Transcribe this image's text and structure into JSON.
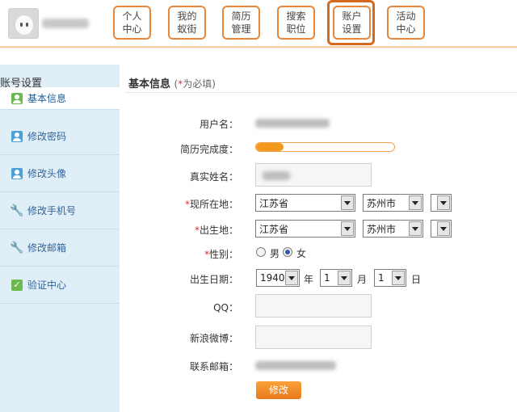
{
  "header": {
    "nav": [
      {
        "line1": "个人",
        "line2": "中心"
      },
      {
        "line1": "我的",
        "line2": "蚁街"
      },
      {
        "line1": "简历",
        "line2": "管理"
      },
      {
        "line1": "搜索",
        "line2": "职位"
      },
      {
        "line1": "账户",
        "line2": "设置"
      },
      {
        "line1": "活动",
        "line2": "中心"
      }
    ]
  },
  "sidebar": {
    "title": "账号设置",
    "items": [
      {
        "label": "基本信息",
        "icon": "user-icon"
      },
      {
        "label": "修改密码",
        "icon": "user-icon"
      },
      {
        "label": "修改头像",
        "icon": "user-icon"
      },
      {
        "label": "修改手机号",
        "icon": "wrench-icon"
      },
      {
        "label": "修改邮箱",
        "icon": "wrench-icon"
      },
      {
        "label": "验证中心",
        "icon": "check-icon"
      }
    ]
  },
  "main": {
    "title": "基本信息",
    "required_note_open": "(",
    "required_star": "*",
    "required_note_text": "为必填)",
    "labels": {
      "username": "用户名：",
      "completion": "简历完成度：",
      "realname": "真实姓名：",
      "current_location": "现所在地：",
      "birthplace": "出生地：",
      "gender": "性别：",
      "birthdate": "出生日期：",
      "qq": "QQ：",
      "weibo": "新浪微博：",
      "email": "联系邮箱："
    },
    "required_mark": "*",
    "resume_completion": 0.2,
    "current_location": {
      "province": "江苏省",
      "city": "苏州市",
      "district": ""
    },
    "birthplace": {
      "province": "江苏省",
      "city": "苏州市",
      "district": ""
    },
    "gender": {
      "male": "男",
      "female": "女",
      "selected": "female"
    },
    "birthdate": {
      "year": "1940",
      "year_unit": "年",
      "month": "1",
      "month_unit": "月",
      "day": "1",
      "day_unit": "日"
    },
    "submit_label": "修改"
  }
}
